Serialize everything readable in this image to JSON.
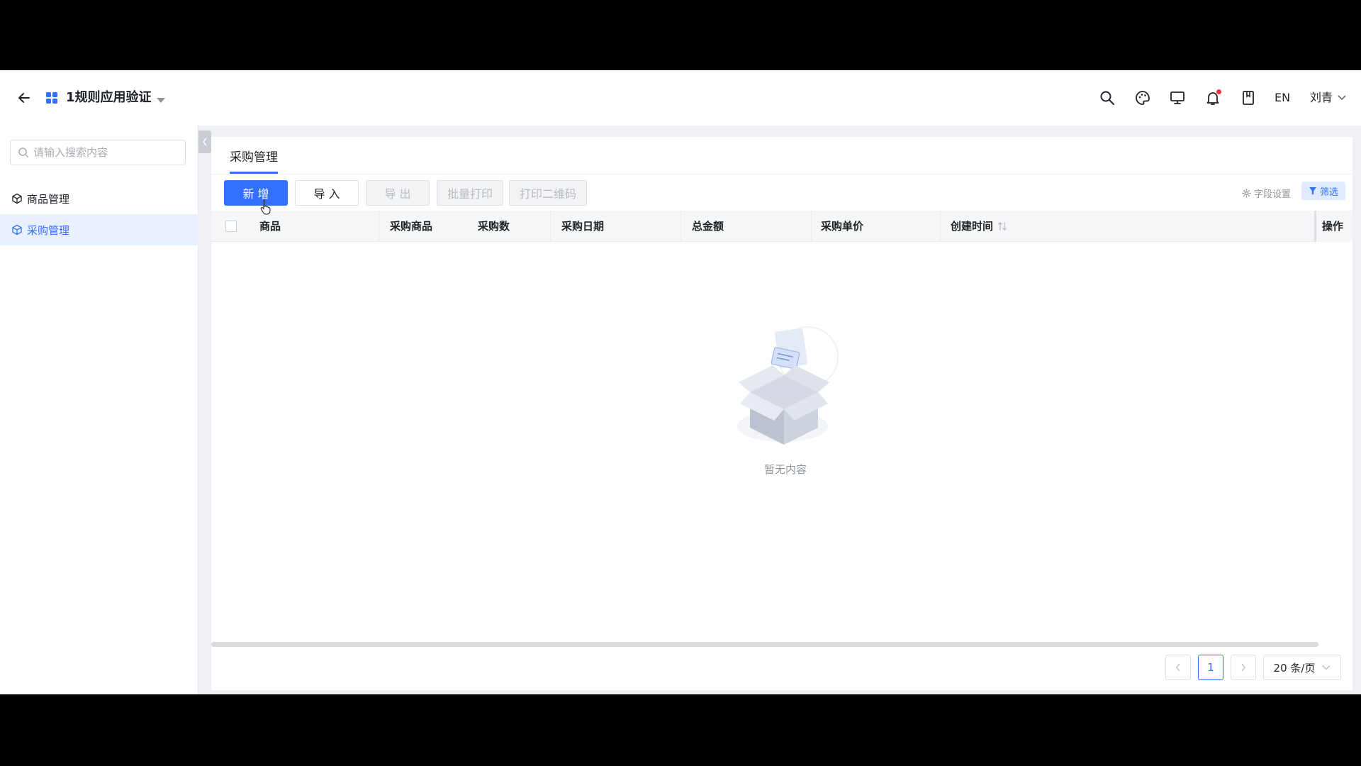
{
  "header": {
    "app_title": "1规则应用验证",
    "lang": "EN",
    "user": "刘青"
  },
  "sidebar": {
    "search_placeholder": "请输入搜索内容",
    "items": [
      {
        "label": "商品管理"
      },
      {
        "label": "采购管理"
      }
    ]
  },
  "main": {
    "tab": "采购管理",
    "toolbar": {
      "add": "新 增",
      "import": "导 入",
      "export": "导 出",
      "batch_print": "批量打印",
      "print_qr": "打印二维码",
      "field_settings": "字段设置",
      "filter": "筛选"
    },
    "columns": [
      "商品",
      "采购商品",
      "采购数",
      "采购日期",
      "总金额",
      "采购单价",
      "创建时间"
    ],
    "op_column": "操作",
    "empty_text": "暂无内容",
    "pagination": {
      "current_page": "1",
      "page_size": "20 条/页"
    }
  },
  "colors": {
    "accent": "#3370ff",
    "active_bg": "#e8f0fd"
  }
}
